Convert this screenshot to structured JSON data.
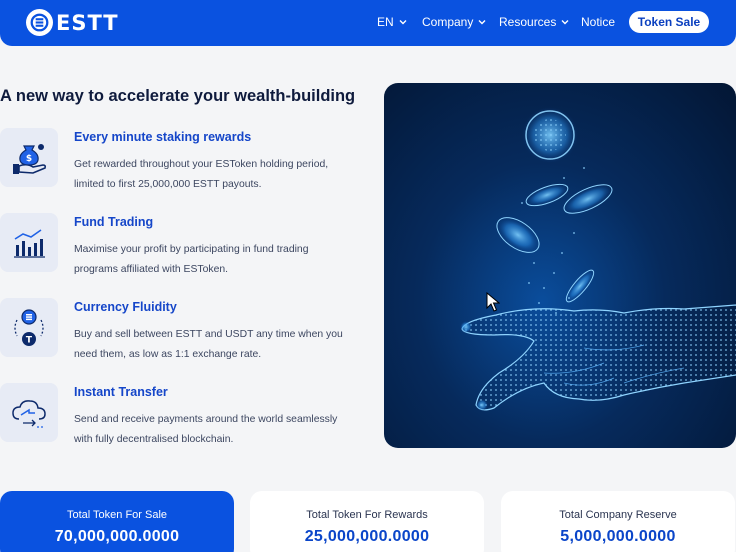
{
  "nav": {
    "logo_text": "ESTT",
    "items": [
      {
        "label": "EN"
      },
      {
        "label": "Company"
      },
      {
        "label": "Resources"
      },
      {
        "label": "Notice"
      }
    ],
    "cta_label": "Token Sale"
  },
  "main": {
    "headline": "A new way to accelerate your wealth-building",
    "features": [
      {
        "title": "Every minute staking rewards",
        "desc": "Get rewarded throughout your ESToken holding period, limited to first 25,000,000 ESTT payouts.",
        "icon": "money-bag-hand-icon"
      },
      {
        "title": "Fund Trading",
        "desc": "Maximise your profit by participating in fund trading programs affiliated with ESToken.",
        "icon": "bar-chart-icon"
      },
      {
        "title": "Currency Fluidity",
        "desc": "Buy and sell between ESTT and USDT any time when you need them, as low as 1:1 exchange rate.",
        "icon": "currency-exchange-icon"
      },
      {
        "title": "Instant Transfer",
        "desc": "Send and receive payments around the world seamlessly with fully decentralised blockchain.",
        "icon": "cloud-transfer-icon"
      }
    ]
  },
  "stats": [
    {
      "label": "Total Token For Sale",
      "value": "70,000,000.0000"
    },
    {
      "label": "Total Token For Rewards",
      "value": "25,000,000.0000"
    },
    {
      "label": "Total Company Reserve",
      "value": "5,000,000.0000"
    }
  ],
  "colors": {
    "brand": "#0a52e0",
    "title_blue": "#1546c9",
    "background": "#f4f5f7"
  }
}
